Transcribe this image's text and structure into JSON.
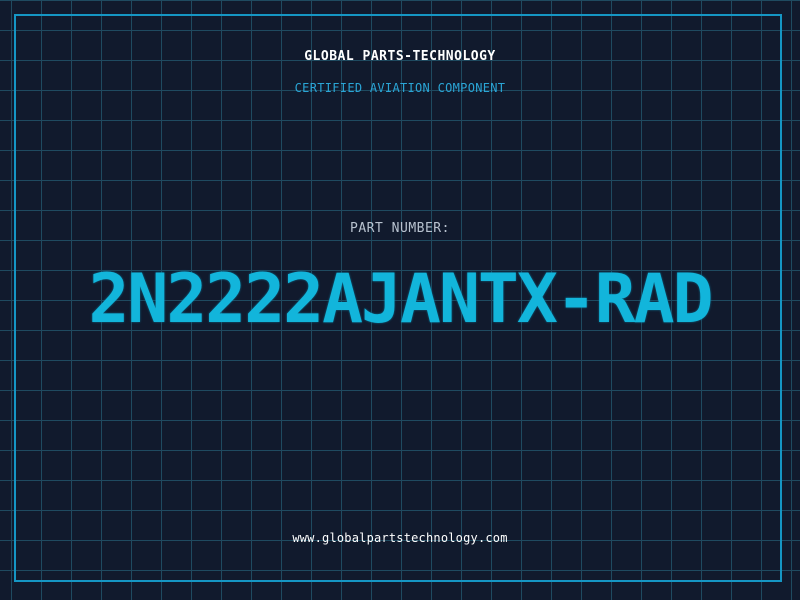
{
  "header": {
    "company": "GLOBAL PARTS-TECHNOLOGY",
    "subtitle": "CERTIFIED AVIATION COMPONENT"
  },
  "part": {
    "label": "PART NUMBER:",
    "number": "2N2222AJANTX-RAD"
  },
  "footer": {
    "url": "www.globalpartstechnology.com"
  },
  "colors": {
    "background": "#111a2d",
    "grid": "#1f4a60",
    "frame": "#1596c4",
    "accent": "#12b5db",
    "subtitle": "#2aa5d6",
    "label": "#b8c2cf",
    "text": "#ffffff"
  }
}
